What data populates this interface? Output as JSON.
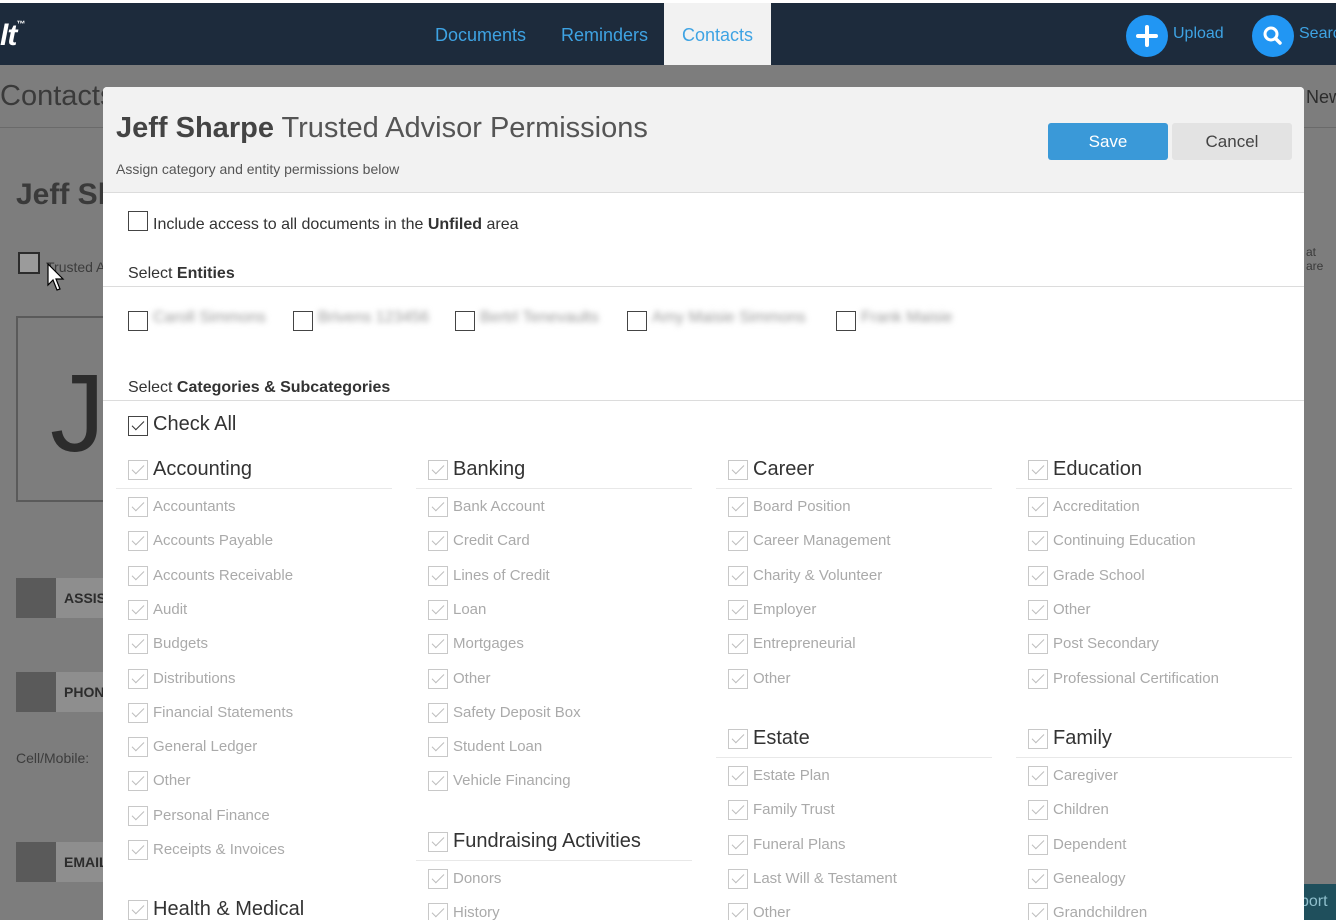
{
  "topnav": {
    "logo": "lt",
    "tabs": [
      {
        "label": "Documents"
      },
      {
        "label": "Reminders"
      },
      {
        "label": "Contacts",
        "active": true
      }
    ],
    "upload_label": "Upload",
    "search_label": "Searc"
  },
  "background": {
    "page_title": "Contacts",
    "contact_name": "Jeff Sh",
    "trusted_label": "Trusted A",
    "avatar_letter": "J",
    "sections": [
      {
        "label": "ASSIS"
      },
      {
        "label": "PHON"
      },
      {
        "label": "EMAIL"
      }
    ],
    "cell_label": "Cell/Mobile:",
    "new_label": "New",
    "right_note": "at are",
    "support_label": "port"
  },
  "modal": {
    "title_name": "Jeff Sharpe",
    "title_rest": " Trusted Advisor Permissions",
    "subtitle": "Assign category and entity permissions below",
    "save_label": "Save",
    "cancel_label": "Cancel",
    "unfiled_pre": "Include access to all documents in the ",
    "unfiled_bold": "Unfiled",
    "unfiled_post": " area",
    "entities_pre": "Select ",
    "entities_bold": "Entities",
    "entities": [
      {
        "label": "Caroll Simmons"
      },
      {
        "label": "Brivens 123456"
      },
      {
        "label": "Bertrl Tenevaults"
      },
      {
        "label": "Amy Maisie Simmons"
      },
      {
        "label": "Frank Maisie"
      }
    ],
    "categories_pre": "Select ",
    "categories_bold": "Categories & Subcategories",
    "check_all_label": "Check All",
    "categories": [
      {
        "name": "Accounting",
        "subs": [
          "Accountants",
          "Accounts Payable",
          "Accounts Receivable",
          "Audit",
          "Budgets",
          "Distributions",
          "Financial Statements",
          "General Ledger",
          "Other",
          "Personal Finance",
          "Receipts & Invoices"
        ]
      },
      {
        "name": "Banking",
        "subs": [
          "Bank Account",
          "Credit Card",
          "Lines of Credit",
          "Loan",
          "Mortgages",
          "Other",
          "Safety Deposit Box",
          "Student Loan",
          "Vehicle Financing"
        ]
      },
      {
        "name": "Career",
        "subs": [
          "Board Position",
          "Career Management",
          "Charity & Volunteer",
          "Employer",
          "Entrepreneurial",
          "Other"
        ]
      },
      {
        "name": "Education",
        "subs": [
          "Accreditation",
          "Continuing Education",
          "Grade School",
          "Other",
          "Post Secondary",
          "Professional Certification"
        ]
      },
      {
        "name": "Estate",
        "subs": [
          "Estate Plan",
          "Family Trust",
          "Funeral Plans",
          "Last Will & Testament",
          "Other"
        ]
      },
      {
        "name": "Family",
        "subs": [
          "Caregiver",
          "Children",
          "Dependent",
          "Genealogy",
          "Grandchildren"
        ]
      },
      {
        "name": "Fundraising Activities",
        "subs": [
          "Donors",
          "History"
        ]
      },
      {
        "name": "Health & Medical",
        "subs": []
      }
    ]
  }
}
